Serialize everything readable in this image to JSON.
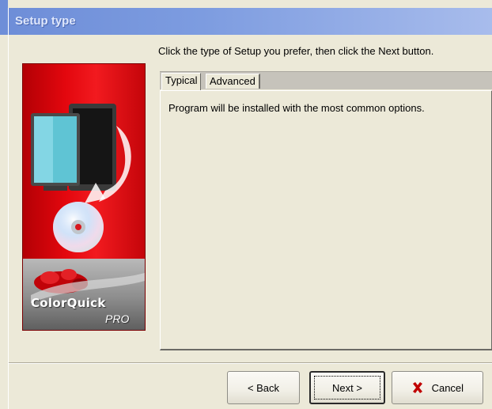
{
  "window": {
    "title": "Setup type"
  },
  "instruction": "Click the type of Setup you prefer, then click the Next button.",
  "banner": {
    "brand_name": "ColorQuick",
    "edition": "PRO"
  },
  "tabs": [
    {
      "label": "Typical",
      "selected": true
    },
    {
      "label": "Advanced",
      "selected": false
    }
  ],
  "panel": {
    "description": "Program will be installed with the most common options."
  },
  "buttons": {
    "back": "< Back",
    "next": "Next >",
    "cancel": "Cancel"
  },
  "colors": {
    "titlebar": "#7d9ce0",
    "banner_red": "#e3070e",
    "face": "#ece9d8",
    "cancel_icon": "#c00000"
  },
  "icons": {
    "cancel": "x-icon"
  }
}
